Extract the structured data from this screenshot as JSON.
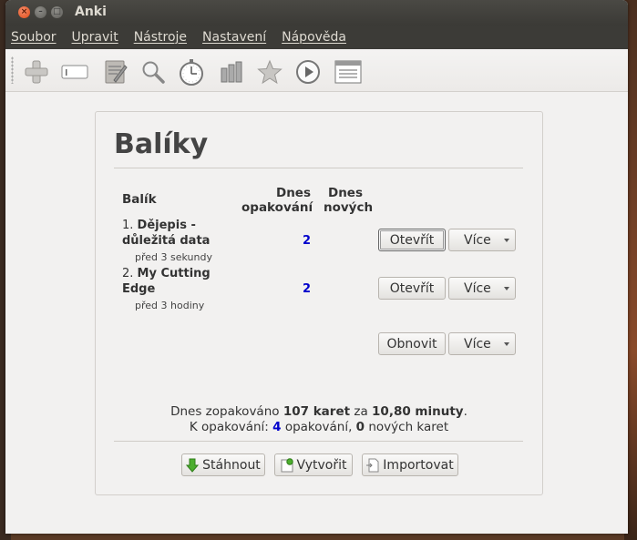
{
  "window": {
    "title": "Anki",
    "close_glyph": "×",
    "min_glyph": "–",
    "max_glyph": "□"
  },
  "menu": [
    "Soubor",
    "Upravit",
    "Nástroje",
    "Nastavení",
    "Nápověda"
  ],
  "toolbar_icons": [
    "add-icon",
    "browse-icon",
    "edit-icon",
    "search-icon",
    "stopwatch-icon",
    "stats-icon",
    "star-icon",
    "play-icon",
    "card-list-icon"
  ],
  "main": {
    "heading": "Balíky",
    "columns": {
      "deck": "Balík",
      "due_line1": "Dnes",
      "due_line2": "opakování",
      "new_line1": "Dnes",
      "new_line2": "nových"
    },
    "decks": [
      {
        "index": "1.",
        "name_line1": "Dějepis -",
        "name_line2": "důležitá data",
        "ago": "před 3 sekundy",
        "due": "2",
        "new": "",
        "open_label": "Otevřít",
        "more_label": "Více"
      },
      {
        "index": "2.",
        "name_line1": "My Cutting",
        "name_line2": "Edge",
        "ago": "před 3 hodiny",
        "due": "2",
        "new": "",
        "open_label": "Otevřít",
        "more_label": "Více"
      }
    ],
    "refresh_label": "Obnovit",
    "refresh_more_label": "Více",
    "stats": {
      "l1_prefix": "Dnes zopakováno ",
      "l1_cards": "107 karet",
      "l1_mid": " za ",
      "l1_time": "10,80 minuty",
      "l1_end": ".",
      "l2_prefix": "K opakování: ",
      "l2_due": "4",
      "l2_mid": " opakování, ",
      "l2_new": "0",
      "l2_end": " nových karet"
    },
    "bottom_buttons": {
      "download": "Stáhnout",
      "create": "Vytvořit",
      "import": "Importovat"
    }
  },
  "colors": {
    "due_blue": "#0000cc",
    "titlebar": "#3c3b37",
    "close_orange": "#df4b16"
  }
}
